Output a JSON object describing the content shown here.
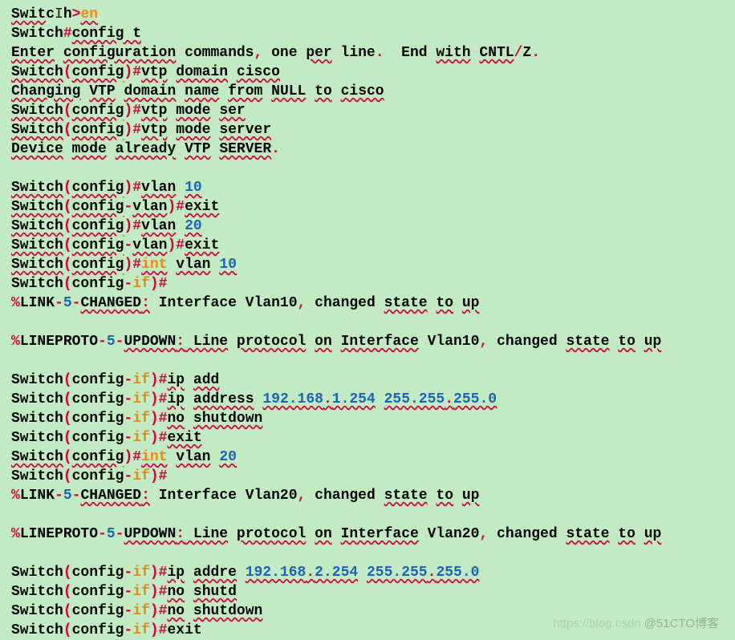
{
  "lines": [
    [
      [
        "ul",
        "Swit"
      ],
      [
        "",
        "c"
      ],
      [
        "cursor",
        "I"
      ],
      [
        "",
        "h"
      ],
      [
        "t-red",
        ">"
      ],
      [
        "ul t-orange",
        "en"
      ]
    ],
    [
      [
        "",
        "Switch"
      ],
      [
        "t-red",
        "#"
      ],
      [
        "ul",
        "config t"
      ]
    ],
    [
      [
        "ul",
        "Enter"
      ],
      [
        "",
        " "
      ],
      [
        "ul",
        "configuration"
      ],
      [
        "",
        " commands"
      ],
      [
        "t-red",
        ","
      ],
      [
        "",
        " one "
      ],
      [
        "ul",
        "per"
      ],
      [
        "",
        " line"
      ],
      [
        "t-red",
        "."
      ],
      [
        "",
        "  End "
      ],
      [
        "ul",
        "with"
      ],
      [
        "",
        " "
      ],
      [
        "ul",
        "CNTL"
      ],
      [
        "t-red",
        "/"
      ],
      [
        "",
        "Z"
      ],
      [
        "t-red",
        "."
      ]
    ],
    [
      [
        "ul",
        "Switch"
      ],
      [
        "t-red",
        "("
      ],
      [
        "ul",
        "config"
      ],
      [
        "t-red",
        ")"
      ],
      [
        "t-red",
        "#"
      ],
      [
        "ul",
        "vtp"
      ],
      [
        "",
        " "
      ],
      [
        "ul",
        "domain"
      ],
      [
        "",
        " "
      ],
      [
        "ul",
        "cisco"
      ]
    ],
    [
      [
        "ul",
        "Changing"
      ],
      [
        "",
        " "
      ],
      [
        "ul",
        "VTP"
      ],
      [
        "",
        " "
      ],
      [
        "ul",
        "domain"
      ],
      [
        "",
        " "
      ],
      [
        "ul",
        "name"
      ],
      [
        "",
        " "
      ],
      [
        "ul",
        "from"
      ],
      [
        "",
        " "
      ],
      [
        "ul",
        "NULL"
      ],
      [
        "",
        " "
      ],
      [
        "ul",
        "to"
      ],
      [
        "",
        " "
      ],
      [
        "ul",
        "cisco"
      ]
    ],
    [
      [
        "ul",
        "Switch"
      ],
      [
        "t-red",
        "("
      ],
      [
        "ul",
        "config"
      ],
      [
        "t-red",
        ")"
      ],
      [
        "t-red",
        "#"
      ],
      [
        "ul",
        "vtp"
      ],
      [
        "",
        " "
      ],
      [
        "ul",
        "mode"
      ],
      [
        "",
        " "
      ],
      [
        "ul",
        "ser"
      ]
    ],
    [
      [
        "ul",
        "Switch"
      ],
      [
        "t-red",
        "("
      ],
      [
        "ul",
        "config"
      ],
      [
        "t-red",
        ")"
      ],
      [
        "t-red",
        "#"
      ],
      [
        "ul",
        "vtp"
      ],
      [
        "",
        " "
      ],
      [
        "ul",
        "mode"
      ],
      [
        "",
        " "
      ],
      [
        "ul",
        "server"
      ]
    ],
    [
      [
        "ul",
        "Device"
      ],
      [
        "",
        " "
      ],
      [
        "ul",
        "mode"
      ],
      [
        "",
        " "
      ],
      [
        "ul",
        "already"
      ],
      [
        "",
        " "
      ],
      [
        "ul",
        "VTP"
      ],
      [
        "",
        " "
      ],
      [
        "ul",
        "SERVER"
      ],
      [
        "t-red",
        "."
      ]
    ],
    [
      [
        "",
        ""
      ]
    ],
    [
      [
        "ul",
        "Switch"
      ],
      [
        "t-red",
        "("
      ],
      [
        "ul",
        "config"
      ],
      [
        "t-red",
        ")"
      ],
      [
        "t-red",
        "#"
      ],
      [
        "ul",
        "vlan"
      ],
      [
        "",
        " "
      ],
      [
        "ul t-blue",
        "10"
      ]
    ],
    [
      [
        "ul",
        "Switch"
      ],
      [
        "t-red",
        "("
      ],
      [
        "ul",
        "config"
      ],
      [
        "t-red",
        "-"
      ],
      [
        "ul",
        "vlan"
      ],
      [
        "t-red",
        ")"
      ],
      [
        "t-red",
        "#"
      ],
      [
        "ul",
        "exit"
      ]
    ],
    [
      [
        "ul",
        "Switch"
      ],
      [
        "t-red",
        "("
      ],
      [
        "ul",
        "config"
      ],
      [
        "t-red",
        ")"
      ],
      [
        "t-red",
        "#"
      ],
      [
        "ul",
        "vlan"
      ],
      [
        "",
        " "
      ],
      [
        "ul t-blue",
        "20"
      ]
    ],
    [
      [
        "ul",
        "Switch"
      ],
      [
        "t-red",
        "("
      ],
      [
        "ul",
        "config"
      ],
      [
        "t-red",
        "-"
      ],
      [
        "ul",
        "vlan"
      ],
      [
        "t-red",
        ")"
      ],
      [
        "t-red",
        "#"
      ],
      [
        "ul",
        "exit"
      ]
    ],
    [
      [
        "ul",
        "Switch"
      ],
      [
        "t-red",
        "("
      ],
      [
        "ul",
        "config"
      ],
      [
        "t-red",
        ")"
      ],
      [
        "t-red",
        "#"
      ],
      [
        "ul t-orange",
        "int"
      ],
      [
        "",
        " "
      ],
      [
        "ul",
        "vlan"
      ],
      [
        "",
        " "
      ],
      [
        "ul t-blue",
        "10"
      ]
    ],
    [
      [
        "",
        "Switch"
      ],
      [
        "t-red",
        "("
      ],
      [
        "",
        "config"
      ],
      [
        "t-red",
        "-"
      ],
      [
        "t-orange",
        "if"
      ],
      [
        "t-red",
        ")"
      ],
      [
        "t-red",
        "#"
      ]
    ],
    [
      [
        "t-red",
        "%"
      ],
      [
        "",
        "LINK"
      ],
      [
        "t-red",
        "-"
      ],
      [
        "t-blue",
        "5"
      ],
      [
        "t-red",
        "-"
      ],
      [
        "ul",
        "CHANGED"
      ],
      [
        "ul t-red",
        ":"
      ],
      [
        "",
        " Interface Vlan10"
      ],
      [
        "t-red",
        ","
      ],
      [
        "",
        " changed "
      ],
      [
        "ul",
        "state"
      ],
      [
        "",
        " "
      ],
      [
        "ul",
        "to"
      ],
      [
        "",
        " "
      ],
      [
        "ul",
        "up"
      ]
    ],
    [
      [
        "",
        ""
      ]
    ],
    [
      [
        "t-red",
        "%"
      ],
      [
        "",
        "LINEPROTO"
      ],
      [
        "t-red",
        "-"
      ],
      [
        "t-blue",
        "5"
      ],
      [
        "t-red",
        "-"
      ],
      [
        "ul",
        "UPDOWN"
      ],
      [
        "ul t-red",
        ":"
      ],
      [
        "ul",
        " Line"
      ],
      [
        "",
        " "
      ],
      [
        "ul",
        "protocol"
      ],
      [
        "",
        " "
      ],
      [
        "ul",
        "on"
      ],
      [
        "",
        " "
      ],
      [
        "ul",
        "Interface"
      ],
      [
        "",
        " Vlan10"
      ],
      [
        "t-red",
        ","
      ],
      [
        "",
        " changed "
      ],
      [
        "ul",
        "state"
      ],
      [
        "",
        " "
      ],
      [
        "ul",
        "to"
      ],
      [
        "",
        " "
      ],
      [
        "ul",
        "up"
      ]
    ],
    [
      [
        "",
        ""
      ]
    ],
    [
      [
        "",
        "Switch"
      ],
      [
        "t-red",
        "("
      ],
      [
        "",
        "config"
      ],
      [
        "t-red",
        "-"
      ],
      [
        "t-orange",
        "if"
      ],
      [
        "t-red",
        ")"
      ],
      [
        "t-red",
        "#"
      ],
      [
        "ul",
        "ip"
      ],
      [
        "",
        " "
      ],
      [
        "ul",
        "add"
      ]
    ],
    [
      [
        "",
        "Switch"
      ],
      [
        "t-red",
        "("
      ],
      [
        "",
        "config"
      ],
      [
        "t-red",
        "-"
      ],
      [
        "t-orange",
        "if"
      ],
      [
        "t-red",
        ")"
      ],
      [
        "t-red",
        "#"
      ],
      [
        "ul",
        "ip"
      ],
      [
        "",
        " "
      ],
      [
        "ul",
        "address"
      ],
      [
        "",
        " "
      ],
      [
        "ul t-blue",
        "192.168"
      ],
      [
        "ul t-red",
        "."
      ],
      [
        "ul t-blue",
        "1.254"
      ],
      [
        "",
        " "
      ],
      [
        "ul t-blue",
        "255.255"
      ],
      [
        "ul t-red",
        "."
      ],
      [
        "ul t-blue",
        "255.0"
      ]
    ],
    [
      [
        "",
        "Switch"
      ],
      [
        "t-red",
        "("
      ],
      [
        "",
        "config"
      ],
      [
        "t-red",
        "-"
      ],
      [
        "t-orange",
        "if"
      ],
      [
        "t-red",
        ")"
      ],
      [
        "t-red",
        "#"
      ],
      [
        "ul",
        "no"
      ],
      [
        "",
        " "
      ],
      [
        "ul",
        "shutdown"
      ]
    ],
    [
      [
        "",
        "Switch"
      ],
      [
        "t-red",
        "("
      ],
      [
        "",
        "config"
      ],
      [
        "t-red",
        "-"
      ],
      [
        "t-orange",
        "if"
      ],
      [
        "t-red",
        ")"
      ],
      [
        "t-red",
        "#"
      ],
      [
        "ul",
        "exit"
      ]
    ],
    [
      [
        "ul",
        "Switch"
      ],
      [
        "t-red",
        "("
      ],
      [
        "ul",
        "config"
      ],
      [
        "t-red",
        ")"
      ],
      [
        "t-red",
        "#"
      ],
      [
        "ul t-orange",
        "int"
      ],
      [
        "",
        " "
      ],
      [
        "ul",
        "vlan"
      ],
      [
        "",
        " "
      ],
      [
        "ul t-blue",
        "20"
      ]
    ],
    [
      [
        "",
        "Switch"
      ],
      [
        "t-red",
        "("
      ],
      [
        "",
        "config"
      ],
      [
        "t-red",
        "-"
      ],
      [
        "t-orange",
        "if"
      ],
      [
        "t-red",
        ")"
      ],
      [
        "t-red",
        "#"
      ]
    ],
    [
      [
        "t-red",
        "%"
      ],
      [
        "",
        "LINK"
      ],
      [
        "t-red",
        "-"
      ],
      [
        "t-blue",
        "5"
      ],
      [
        "t-red",
        "-"
      ],
      [
        "ul",
        "CHANGED"
      ],
      [
        "ul t-red",
        ":"
      ],
      [
        "",
        " Interface Vlan20"
      ],
      [
        "t-red",
        ","
      ],
      [
        "",
        " changed "
      ],
      [
        "ul",
        "state"
      ],
      [
        "",
        " "
      ],
      [
        "ul",
        "to"
      ],
      [
        "",
        " "
      ],
      [
        "ul",
        "up"
      ]
    ],
    [
      [
        "",
        ""
      ]
    ],
    [
      [
        "t-red",
        "%"
      ],
      [
        "",
        "LINEPROTO"
      ],
      [
        "t-red",
        "-"
      ],
      [
        "t-blue",
        "5"
      ],
      [
        "t-red",
        "-"
      ],
      [
        "ul",
        "UPDOWN"
      ],
      [
        "ul t-red",
        ":"
      ],
      [
        "ul",
        " Line"
      ],
      [
        "",
        " "
      ],
      [
        "ul",
        "protocol"
      ],
      [
        "",
        " "
      ],
      [
        "ul",
        "on"
      ],
      [
        "",
        " "
      ],
      [
        "ul",
        "Interface"
      ],
      [
        "",
        " Vlan20"
      ],
      [
        "t-red",
        ","
      ],
      [
        "",
        " changed "
      ],
      [
        "ul",
        "state"
      ],
      [
        "",
        " "
      ],
      [
        "ul",
        "to"
      ],
      [
        "",
        " "
      ],
      [
        "ul",
        "up"
      ]
    ],
    [
      [
        "",
        ""
      ]
    ],
    [
      [
        "",
        "Switch"
      ],
      [
        "t-red",
        "("
      ],
      [
        "",
        "config"
      ],
      [
        "t-red",
        "-"
      ],
      [
        "t-orange",
        "if"
      ],
      [
        "t-red",
        ")"
      ],
      [
        "t-red",
        "#"
      ],
      [
        "ul",
        "ip"
      ],
      [
        "",
        " "
      ],
      [
        "ul",
        "addre"
      ],
      [
        "",
        " "
      ],
      [
        "ul t-blue",
        "192.168"
      ],
      [
        "ul t-red",
        "."
      ],
      [
        "ul t-blue",
        "2.254"
      ],
      [
        "",
        " "
      ],
      [
        "ul t-blue",
        "255.255"
      ],
      [
        "ul t-red",
        "."
      ],
      [
        "ul t-blue",
        "255.0"
      ]
    ],
    [
      [
        "",
        "Switch"
      ],
      [
        "t-red",
        "("
      ],
      [
        "",
        "config"
      ],
      [
        "t-red",
        "-"
      ],
      [
        "t-orange",
        "if"
      ],
      [
        "t-red",
        ")"
      ],
      [
        "t-red",
        "#"
      ],
      [
        "ul",
        "no"
      ],
      [
        "",
        " "
      ],
      [
        "ul",
        "shutd"
      ]
    ],
    [
      [
        "",
        "Switch"
      ],
      [
        "t-red",
        "("
      ],
      [
        "",
        "config"
      ],
      [
        "t-red",
        "-"
      ],
      [
        "t-orange",
        "if"
      ],
      [
        "t-red",
        ")"
      ],
      [
        "t-red",
        "#"
      ],
      [
        "ul",
        "no"
      ],
      [
        "",
        " "
      ],
      [
        "ul",
        "shutdown"
      ]
    ],
    [
      [
        "",
        "Switch"
      ],
      [
        "t-red",
        "("
      ],
      [
        "",
        "config"
      ],
      [
        "t-red",
        "-"
      ],
      [
        "t-orange",
        "if"
      ],
      [
        "t-red",
        ")"
      ],
      [
        "t-red",
        "#"
      ],
      [
        "",
        "exit"
      ]
    ]
  ],
  "watermark": {
    "faint": "https://blog.csdn ",
    "text": "@51CTO博客"
  }
}
